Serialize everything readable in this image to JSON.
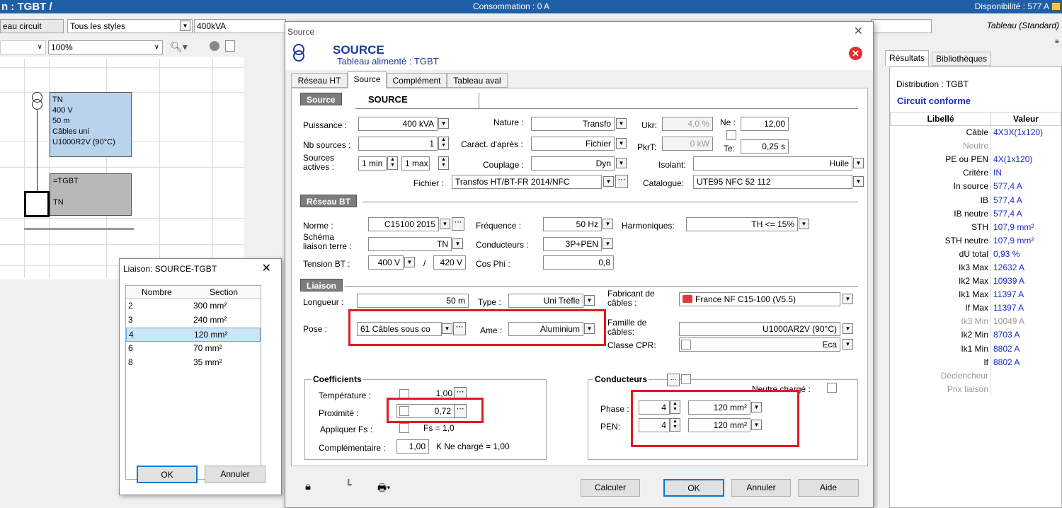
{
  "topbar": {
    "title": "n : TGBT /",
    "consumption": "Consommation : 0 A",
    "availability": "Disponibilité : 577 A"
  },
  "toolbar": {
    "circuit_btn": "eau circuit",
    "style_select": "Tous les styles",
    "power_field": "400kVA",
    "zoom": "100%",
    "right_label": "Tableau (Standard)"
  },
  "schema": {
    "box1_lines": [
      "TN",
      "400 V",
      "50 m",
      "Câbles uni",
      "U1000R2V (90°C)"
    ],
    "box2_top": "=TGBT",
    "box2_bottom": "TN"
  },
  "liaison": {
    "title": "Liaison: SOURCE-TGBT",
    "col_nombre": "Nombre",
    "col_section": "Section",
    "rows": [
      {
        "n": "2",
        "s": "300 mm²"
      },
      {
        "n": "3",
        "s": "240 mm²"
      },
      {
        "n": "4",
        "s": "120 mm²"
      },
      {
        "n": "6",
        "s": "70 mm²"
      },
      {
        "n": "8",
        "s": "35 mm²"
      }
    ],
    "selected_index": 2,
    "ok": "OK",
    "cancel": "Annuler"
  },
  "dialog": {
    "window_title": "Source",
    "header_title": "SOURCE",
    "header_subtitle": "Tableau alimenté : TGBT",
    "tabs": [
      "Réseau HT",
      "Source",
      "Complément",
      "Tableau aval"
    ],
    "active_tab": 1,
    "source_section": "Source",
    "source_name": "SOURCE",
    "puissance_label": "Puissance :",
    "puissance": "400 kVA",
    "nature_label": "Nature :",
    "nature": "Transfo",
    "ukr_label": "Ukr:",
    "ukr": "4,0 %",
    "ne_label": "Ne :",
    "ne": "12,00",
    "nbsources_label": "Nb sources :",
    "nbsources": "1",
    "caract_label": "Caract. d'après :",
    "caract": "Fichier",
    "pkrt_label": "PkrT:",
    "pkrt": "0 kW",
    "te_label": "Te:",
    "te": "0,25 s",
    "sources_actives_label1": "Sources",
    "sources_actives_label2": "actives :",
    "sa_min": "1 min",
    "sa_max": "1 max",
    "couplage_label": "Couplage :",
    "couplage": "Dyn",
    "isolant_label": "Isolant:",
    "isolant": "Huile",
    "fichier_label": "Fichier :",
    "fichier": "Transfos HT/BT-FR 2014/NFC",
    "catalogue_label": "Catalogue:",
    "catalogue": "UTE95 NFC 52 112",
    "bt_section": "Réseau BT",
    "norme_label": "Norme :",
    "norme": "C15100 2015",
    "freq_label": "Fréquence :",
    "freq": "50 Hz",
    "harm_label": "Harmoniques:",
    "harm": "TH <= 15%",
    "schema_label1": "Schéma",
    "schema_label2": "liaison terre :",
    "schema_val": "TN",
    "conducteurs_label": "Conducteurs :",
    "conducteurs": "3P+PEN",
    "tension_label": "Tension BT :",
    "tension1": "400 V",
    "tension_sep": "/",
    "tension2": "420 V",
    "cosphi_label": "Cos Phi :",
    "cosphi": "0,8",
    "liaison_section": "Liaison",
    "longueur_label": "Longueur :",
    "longueur": "50 m",
    "type_label": "Type :",
    "type": "Uni Trèfle",
    "fabricant_label1": "Fabricant de",
    "fabricant_label2": "câbles :",
    "fabricant": "France NF C15-100 (V5.5)",
    "pose_label": "Pose :",
    "pose": "61  Câbles sous co",
    "ame_label": "Ame :",
    "ame": "Aluminium",
    "famille_label1": "Famille de",
    "famille_label2": "câbles:",
    "famille": "U1000AR2V (90°C)",
    "cpr_label": "Classe CPR:",
    "cpr": "Eca",
    "coef_title": "Coefficients",
    "temp_label": "Température :",
    "temp": "1,00",
    "prox_label": "Proximité :",
    "prox": "0,72",
    "fs_label": "Appliquer Fs :",
    "fs_text": "Fs = 1,0",
    "compl_label": "Complémentaire :",
    "compl": "1,00",
    "kne_text": "K Ne chargé = 1,00",
    "cond_title": "Conducteurs",
    "ell": "...",
    "neutre_label": "Neutre chargé :",
    "phase_label": "Phase :",
    "phase_n": "4",
    "phase_s": "120 mm²",
    "pen_label": "PEN:",
    "pen_n": "4",
    "pen_s": "120 mm²",
    "btn_calc": "Calculer",
    "btn_ok": "OK",
    "btn_cancel": "Annuler",
    "btn_help": "Aide"
  },
  "results": {
    "tabs": [
      "Résultats",
      "Bibliothèques"
    ],
    "distribution": "Distribution : TGBT",
    "conforme": "Circuit conforme",
    "col_libelle": "Libellé",
    "col_valeur": "Valeur",
    "rows": [
      {
        "l": "Câble",
        "v": "4X3X(1x120)"
      },
      {
        "l": "Neutre",
        "v": "",
        "grey": true
      },
      {
        "l": "PE ou PEN",
        "v": "4X(1x120)"
      },
      {
        "l": "Critère",
        "v": "IN"
      },
      {
        "l": "In source",
        "v": "577,4 A"
      },
      {
        "l": "IB",
        "v": "577,4 A"
      },
      {
        "l": "IB neutre",
        "v": "577,4 A"
      },
      {
        "l": "STH",
        "v": "107,9 mm²"
      },
      {
        "l": "STH neutre",
        "v": "107,9 mm²"
      },
      {
        "l": "dU total",
        "v": "0,93 %"
      },
      {
        "l": "Ik3 Max",
        "v": "12632 A"
      },
      {
        "l": "Ik2 Max",
        "v": "10939 A"
      },
      {
        "l": "Ik1 Max",
        "v": "11397 A"
      },
      {
        "l": "If Max",
        "v": "11397 A"
      },
      {
        "l": "Ik3 Min",
        "v": "10049 A",
        "grey": true
      },
      {
        "l": "Ik2 Min",
        "v": "8703 A"
      },
      {
        "l": "Ik1 Min",
        "v": "8802 A"
      },
      {
        "l": "If",
        "v": "8802 A"
      },
      {
        "l": "Déclencheur",
        "v": "",
        "grey": true
      },
      {
        "l": "Prix liaison",
        "v": "",
        "grey": true
      }
    ]
  }
}
